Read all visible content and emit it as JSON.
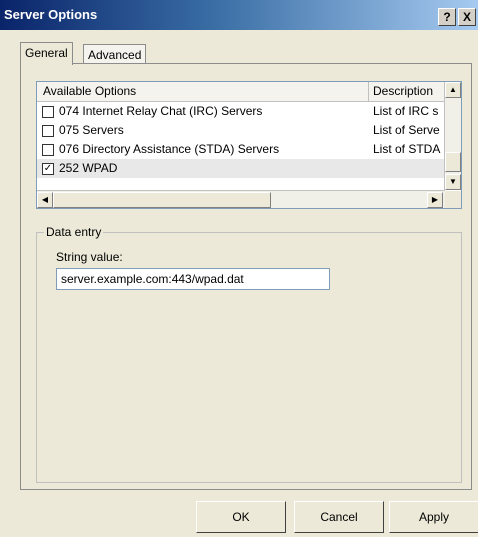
{
  "window": {
    "title": "Server Options",
    "help_label": "?",
    "close_label": "X"
  },
  "tabs": [
    {
      "label": "General",
      "active": true
    },
    {
      "label": "Advanced",
      "active": false
    }
  ],
  "options_list": {
    "columns": [
      "Available Options",
      "Description"
    ],
    "rows": [
      {
        "checked": false,
        "name": "074 Internet Relay Chat (IRC) Servers",
        "description": "List of IRC s"
      },
      {
        "checked": false,
        "name": "075 Servers",
        "description": "List of Serve"
      },
      {
        "checked": false,
        "name": "076 Directory Assistance (STDA) Servers",
        "description": "List of STDA"
      },
      {
        "checked": true,
        "name": "252 WPAD",
        "description": ""
      }
    ]
  },
  "data_entry": {
    "group_label": "Data entry",
    "field_label": "String value:",
    "value": "server.example.com:443/wpad.dat"
  },
  "buttons": {
    "ok": "OK",
    "cancel": "Cancel",
    "apply": "Apply"
  },
  "icons": {
    "check": "✓",
    "scroll_up": "▲",
    "scroll_down": "▼",
    "scroll_left": "◀",
    "scroll_right": "▶"
  }
}
